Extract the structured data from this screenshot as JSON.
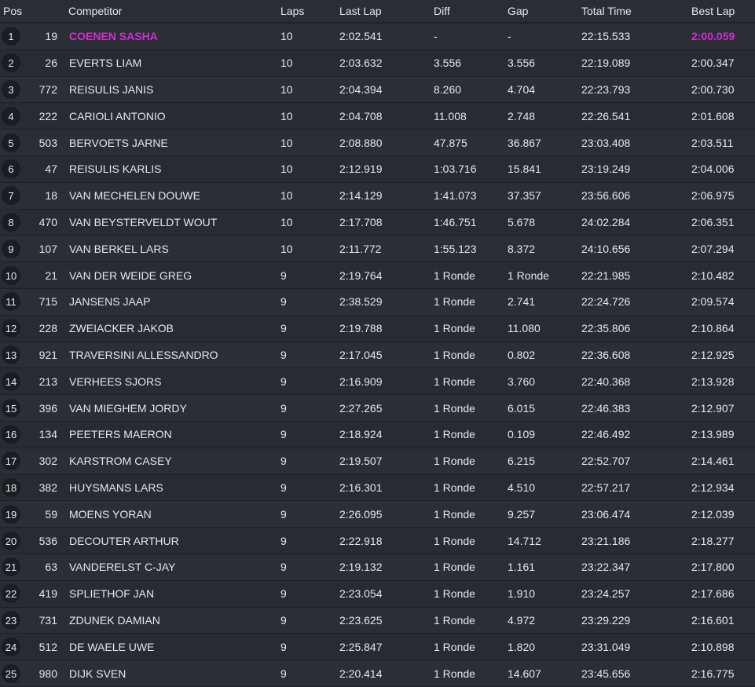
{
  "headers": {
    "pos": "Pos",
    "number": "",
    "competitor": "Competitor",
    "laps": "Laps",
    "last_lap": "Last Lap",
    "diff": "Diff",
    "gap": "Gap",
    "total_time": "Total Time",
    "best_lap": "Best Lap"
  },
  "colors": {
    "background": "#2a2d34",
    "highlight": "#d02fd0"
  },
  "rows": [
    {
      "pos": "1",
      "number": "19",
      "name": "COENEN SASHA",
      "laps": "10",
      "last_lap": "2:02.541",
      "diff": "-",
      "gap": "-",
      "total": "22:15.533",
      "best": "2:00.059"
    },
    {
      "pos": "2",
      "number": "26",
      "name": "EVERTS LIAM",
      "laps": "10",
      "last_lap": "2:03.632",
      "diff": "3.556",
      "gap": "3.556",
      "total": "22:19.089",
      "best": "2:00.347"
    },
    {
      "pos": "3",
      "number": "772",
      "name": "REISULIS JANIS",
      "laps": "10",
      "last_lap": "2:04.394",
      "diff": "8.260",
      "gap": "4.704",
      "total": "22:23.793",
      "best": "2:00.730"
    },
    {
      "pos": "4",
      "number": "222",
      "name": "CARIOLI ANTONIO",
      "laps": "10",
      "last_lap": "2:04.708",
      "diff": "11.008",
      "gap": "2.748",
      "total": "22:26.541",
      "best": "2:01.608"
    },
    {
      "pos": "5",
      "number": "503",
      "name": "BERVOETS JARNE",
      "laps": "10",
      "last_lap": "2:08.880",
      "diff": "47.875",
      "gap": "36.867",
      "total": "23:03.408",
      "best": "2:03.511"
    },
    {
      "pos": "6",
      "number": "47",
      "name": "REISULIS KARLIS",
      "laps": "10",
      "last_lap": "2:12.919",
      "diff": "1:03.716",
      "gap": "15.841",
      "total": "23:19.249",
      "best": "2:04.006"
    },
    {
      "pos": "7",
      "number": "18",
      "name": "VAN MECHELEN DOUWE",
      "laps": "10",
      "last_lap": "2:14.129",
      "diff": "1:41.073",
      "gap": "37.357",
      "total": "23:56.606",
      "best": "2:06.975"
    },
    {
      "pos": "8",
      "number": "470",
      "name": "VAN BEYSTERVELDT WOUT",
      "laps": "10",
      "last_lap": "2:17.708",
      "diff": "1:46.751",
      "gap": "5.678",
      "total": "24:02.284",
      "best": "2:06.351"
    },
    {
      "pos": "9",
      "number": "107",
      "name": "VAN BERKEL LARS",
      "laps": "10",
      "last_lap": "2:11.772",
      "diff": "1:55.123",
      "gap": "8.372",
      "total": "24:10.656",
      "best": "2:07.294"
    },
    {
      "pos": "10",
      "number": "21",
      "name": "VAN DER WEIDE GREG",
      "laps": "9",
      "last_lap": "2:19.764",
      "diff": "1 Ronde",
      "gap": "1 Ronde",
      "total": "22:21.985",
      "best": "2:10.482"
    },
    {
      "pos": "11",
      "number": "715",
      "name": "JANSENS JAAP",
      "laps": "9",
      "last_lap": "2:38.529",
      "diff": "1 Ronde",
      "gap": "2.741",
      "total": "22:24.726",
      "best": "2:09.574"
    },
    {
      "pos": "12",
      "number": "228",
      "name": "ZWEIACKER JAKOB",
      "laps": "9",
      "last_lap": "2:19.788",
      "diff": "1 Ronde",
      "gap": "11.080",
      "total": "22:35.806",
      "best": "2:10.864"
    },
    {
      "pos": "13",
      "number": "921",
      "name": "TRAVERSINI ALLESSANDRO",
      "laps": "9",
      "last_lap": "2:17.045",
      "diff": "1 Ronde",
      "gap": "0.802",
      "total": "22:36.608",
      "best": "2:12.925"
    },
    {
      "pos": "14",
      "number": "213",
      "name": "VERHEES SJORS",
      "laps": "9",
      "last_lap": "2:16.909",
      "diff": "1 Ronde",
      "gap": "3.760",
      "total": "22:40.368",
      "best": "2:13.928"
    },
    {
      "pos": "15",
      "number": "396",
      "name": "VAN MIEGHEM JORDY",
      "laps": "9",
      "last_lap": "2:27.265",
      "diff": "1 Ronde",
      "gap": "6.015",
      "total": "22:46.383",
      "best": "2:12.907"
    },
    {
      "pos": "16",
      "number": "134",
      "name": "PEETERS MAERON",
      "laps": "9",
      "last_lap": "2:18.924",
      "diff": "1 Ronde",
      "gap": "0.109",
      "total": "22:46.492",
      "best": "2:13.989"
    },
    {
      "pos": "17",
      "number": "302",
      "name": "KARSTROM CASEY",
      "laps": "9",
      "last_lap": "2:19.507",
      "diff": "1 Ronde",
      "gap": "6.215",
      "total": "22:52.707",
      "best": "2:14.461"
    },
    {
      "pos": "18",
      "number": "382",
      "name": "HUYSMANS LARS",
      "laps": "9",
      "last_lap": "2:16.301",
      "diff": "1 Ronde",
      "gap": "4.510",
      "total": "22:57.217",
      "best": "2:12.934"
    },
    {
      "pos": "19",
      "number": "59",
      "name": "MOENS YORAN",
      "laps": "9",
      "last_lap": "2:26.095",
      "diff": "1 Ronde",
      "gap": "9.257",
      "total": "23:06.474",
      "best": "2:12.039"
    },
    {
      "pos": "20",
      "number": "536",
      "name": "DECOUTER ARTHUR",
      "laps": "9",
      "last_lap": "2:22.918",
      "diff": "1 Ronde",
      "gap": "14.712",
      "total": "23:21.186",
      "best": "2:18.277"
    },
    {
      "pos": "21",
      "number": "63",
      "name": "VANDERELST C-JAY",
      "laps": "9",
      "last_lap": "2:19.132",
      "diff": "1 Ronde",
      "gap": "1.161",
      "total": "23:22.347",
      "best": "2:17.800"
    },
    {
      "pos": "22",
      "number": "419",
      "name": "SPLIETHOF JAN",
      "laps": "9",
      "last_lap": "2:23.054",
      "diff": "1 Ronde",
      "gap": "1.910",
      "total": "23:24.257",
      "best": "2:17.686"
    },
    {
      "pos": "23",
      "number": "731",
      "name": "ZDUNEK DAMIAN",
      "laps": "9",
      "last_lap": "2:23.625",
      "diff": "1 Ronde",
      "gap": "4.972",
      "total": "23:29.229",
      "best": "2:16.601"
    },
    {
      "pos": "24",
      "number": "512",
      "name": "DE WAELE UWE",
      "laps": "9",
      "last_lap": "2:25.847",
      "diff": "1 Ronde",
      "gap": "1.820",
      "total": "23:31.049",
      "best": "2:10.898"
    },
    {
      "pos": "25",
      "number": "980",
      "name": "DIJK SVEN",
      "laps": "9",
      "last_lap": "2:20.414",
      "diff": "1 Ronde",
      "gap": "14.607",
      "total": "23:45.656",
      "best": "2:16.775"
    }
  ]
}
